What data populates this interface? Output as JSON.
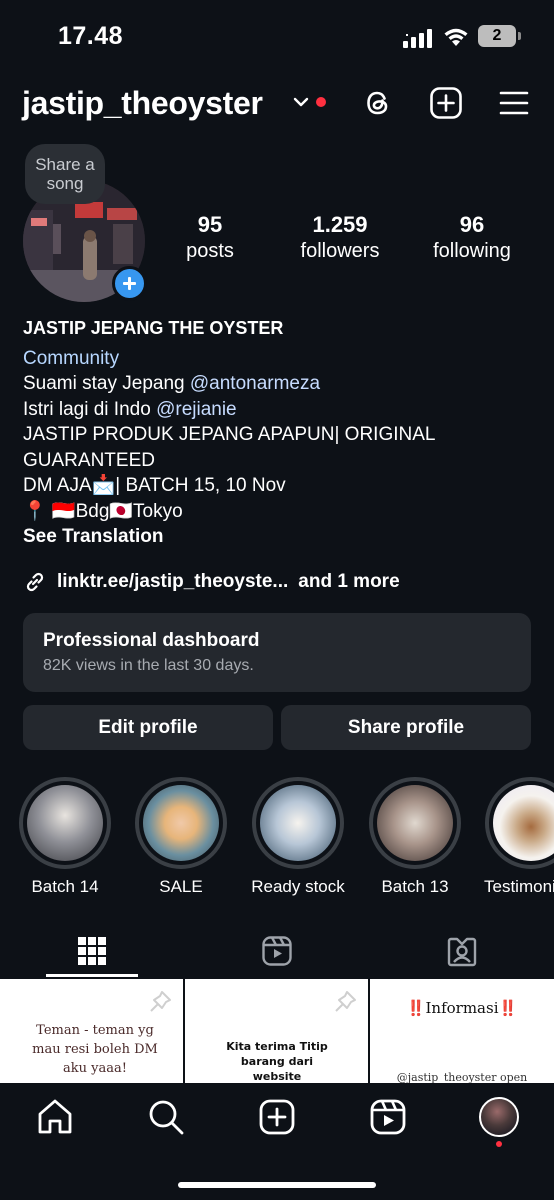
{
  "status": {
    "time": "17.48",
    "battery": "2"
  },
  "header": {
    "username": "jastip_theoyster"
  },
  "profile": {
    "bubble": "Share a song",
    "stats": [
      {
        "value": "95",
        "label": "posts"
      },
      {
        "value": "1.259",
        "label": "followers"
      },
      {
        "value": "96",
        "label": "following"
      }
    ],
    "name": "JASTIP JEPANG THE OYSTER",
    "category": "Community",
    "bio_line1_text": "Suami stay Jepang ",
    "bio_line1_mention": "@antonarmeza",
    "bio_line2_text": "Istri lagi di Indo ",
    "bio_line2_mention": "@rejianie",
    "bio_line3": "JASTIP PRODUK JEPANG APAPUN| ORIGINAL GUARANTEED",
    "bio_line4": "DM AJA📩| BATCH 15, 10 Nov",
    "bio_line5": "📍 🇮🇩Bdg🇯🇵Tokyo",
    "see_translation": "See Translation",
    "link": "linktr.ee/jastip_theoyste...",
    "link_more": "and 1 more"
  },
  "dashboard": {
    "title": "Professional dashboard",
    "subtitle": "82K views in the last 30 days."
  },
  "buttons": {
    "edit": "Edit profile",
    "share": "Share profile"
  },
  "highlights": [
    {
      "label": "Batch 14",
      "color": "#7a7f86"
    },
    {
      "label": "SALE",
      "color": "#d4c9b8"
    },
    {
      "label": "Ready stock",
      "color": "#8fa3b8"
    },
    {
      "label": "Batch 13",
      "color": "#9a8a82"
    },
    {
      "label": "Testimoni",
      "color": "#f4f1ee"
    }
  ],
  "posts": [
    {
      "text": "Teman - teman yg mau resi boleh DM aku yaaa!"
    },
    {
      "text": "Kita terima Titip barang dari website"
    },
    {
      "text": "‼️Informasi‼️",
      "sub": "@jastip_theoyster open"
    }
  ],
  "icons": {
    "threads": "threads-icon",
    "create": "create-icon",
    "menu": "menu-icon",
    "grid": "grid-icon",
    "reels": "reels-icon",
    "tagged": "tagged-icon",
    "home": "home-icon",
    "search": "search-icon",
    "add": "add-icon",
    "reels_nav": "reels-icon",
    "profile": "profile-avatar"
  }
}
